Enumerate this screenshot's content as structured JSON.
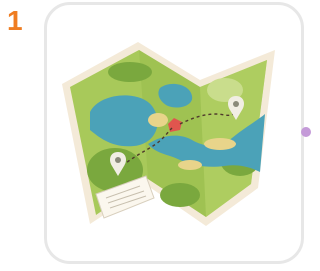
{
  "step": {
    "number": "1"
  },
  "card": {
    "illustration": "folded-map-icon"
  },
  "colors": {
    "step_number": "#ef7d22",
    "card_border": "#e7e7e7",
    "connector_dot": "#c49ad8",
    "map_paper_edge": "#f4ead8",
    "map_land_light": "#a8c95a",
    "map_land_dark": "#7aa83e",
    "map_water": "#4ba2b8",
    "map_sand": "#e8d48a",
    "map_marker_red": "#e0554e"
  }
}
